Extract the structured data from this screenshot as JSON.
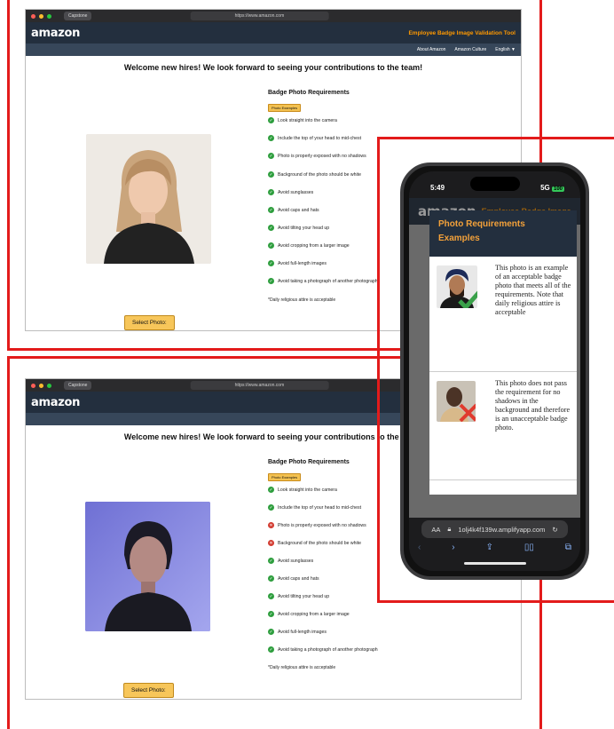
{
  "browser": {
    "tab_label": "Capstone",
    "url": "https://www.amazon.com"
  },
  "header": {
    "logo": "amazon",
    "tool_title": "Employee Badge Image Validation Tool"
  },
  "nav": {
    "items": [
      "About Amazon",
      "Amazon Culture",
      "English ▼"
    ]
  },
  "welcome": "Welcome new hires! We look forward to seeing your contributions to the team!",
  "requirements": {
    "title": "Badge Photo Requirements",
    "examples_button": "Photo Examples",
    "items": [
      "Look straight into the camera",
      "Include the top of your head to mid-chest",
      "Photo is properly exposed with no shadows",
      "Background of the photo should be white",
      "Avoid sunglasses",
      "Avoid caps and hats",
      "Avoid tilting your head up",
      "Avoid cropping from a larger image",
      "Avoid full-length images",
      "Avoid taking a photograph of another photograph"
    ],
    "note": "*Daily religious attire is acceptable"
  },
  "panel_top": {
    "statuses": [
      "ok",
      "ok",
      "ok",
      "ok",
      "ok",
      "ok",
      "ok",
      "ok",
      "ok",
      "ok"
    ]
  },
  "panel_bottom": {
    "statuses": [
      "ok",
      "ok",
      "bad",
      "bad",
      "ok",
      "ok",
      "ok",
      "ok",
      "ok",
      "ok"
    ]
  },
  "select_button": "Select Photo:",
  "phone": {
    "time": "5:49",
    "signal": "5G",
    "battery": "100",
    "logo": "amazon",
    "tool_title": "Employee Badge Image",
    "modal_title": "Photo Requirements Examples",
    "example_good": "This photo is an example of an acceptable badge photo that meets all of the requirements. Note that daily religious attire is acceptable",
    "example_bad": "This photo does not pass the requirement for no shadows in the background and therefore is an unacceptable badge photo.",
    "address": "1olj4k4f139w.amplifyapp.com",
    "address_prefix": "AA"
  },
  "colors": {
    "accent": "#ff9900",
    "frame": "#e31b1b",
    "ok": "#2e9e3e",
    "bad": "#d23a2f",
    "header": "#232f3e"
  }
}
